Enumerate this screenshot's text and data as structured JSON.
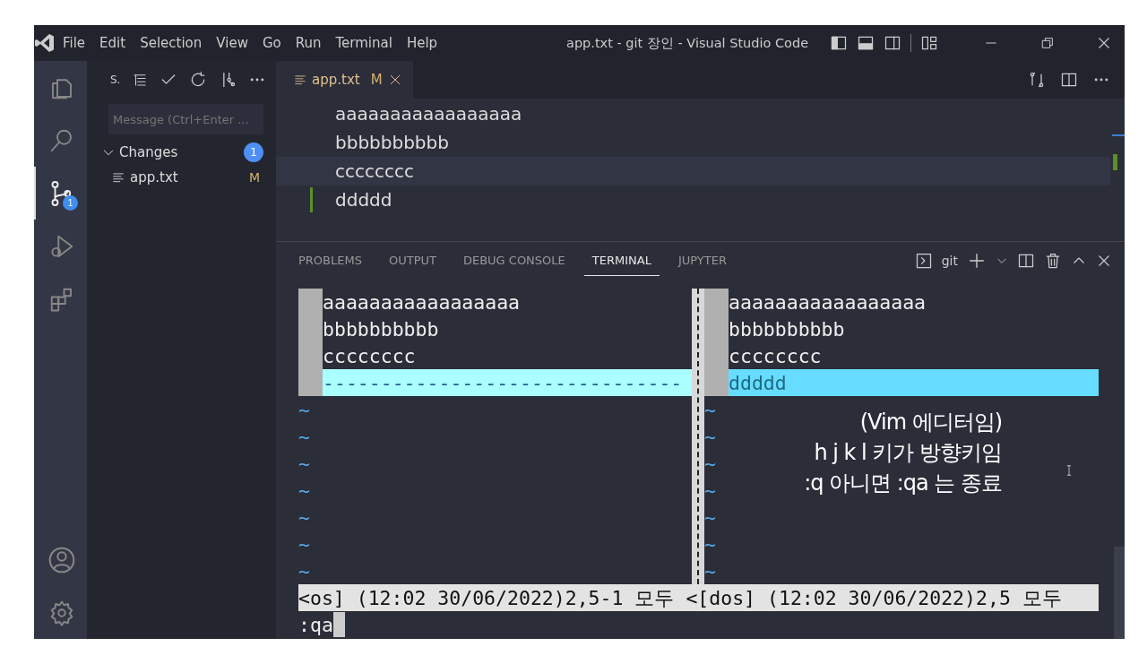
{
  "window": {
    "title": "app.txt - git 장인 - Visual Studio Code"
  },
  "menu": [
    "File",
    "Edit",
    "Selection",
    "View",
    "Go",
    "Run",
    "Terminal",
    "Help"
  ],
  "activity_bar": [
    {
      "kind": "explorer",
      "selected": false
    },
    {
      "kind": "search",
      "selected": false
    },
    {
      "kind": "scm",
      "selected": true,
      "badge": "1"
    },
    {
      "kind": "debug",
      "selected": false
    },
    {
      "kind": "extensions",
      "selected": false
    }
  ],
  "sidebar": {
    "title": "S.",
    "message": {
      "placeholder": "Message (Ctrl+Enter ..."
    },
    "group": {
      "label": "Changes",
      "count": "1",
      "expanded": true,
      "files": [
        {
          "name": "app.txt",
          "status": "M"
        }
      ]
    }
  },
  "editor": {
    "tabs": [
      {
        "label": "app.txt",
        "status": "M",
        "selected": true
      }
    ],
    "lines": [
      {
        "text": "aaaaaaaaaaaaaaaaa",
        "current": false,
        "modified": false
      },
      {
        "text": "bbbbbbbbbb",
        "current": false,
        "modified": false
      },
      {
        "text": "cccccccc",
        "current": true,
        "modified": false
      },
      {
        "text": "ddddd",
        "current": false,
        "modified": true
      }
    ]
  },
  "panel": {
    "tabs": [
      {
        "label": "PROBLEMS",
        "selected": false
      },
      {
        "label": "OUTPUT",
        "selected": false
      },
      {
        "label": "DEBUG CONSOLE",
        "selected": false
      },
      {
        "label": "TERMINAL",
        "selected": true
      },
      {
        "label": "JUPYTER",
        "selected": false
      }
    ],
    "shell": "git",
    "vim": {
      "panes": [
        {
          "lines": [
            {
              "kind": "text",
              "text": "aaaaaaaaaaaaaaaaa"
            },
            {
              "kind": "text",
              "text": "bbbbbbbbbb"
            },
            {
              "kind": "text",
              "text": "cccccccc"
            },
            {
              "kind": "filler",
              "text": "-------------------------------"
            },
            {
              "kind": "tilde",
              "text": "~"
            },
            {
              "kind": "tilde",
              "text": "~"
            },
            {
              "kind": "tilde",
              "text": "~"
            },
            {
              "kind": "tilde",
              "text": "~"
            },
            {
              "kind": "tilde",
              "text": "~"
            },
            {
              "kind": "tilde",
              "text": "~"
            },
            {
              "kind": "tilde",
              "text": "~"
            }
          ],
          "status": "<os] (12:02 30/06/2022)2,5-1 모두"
        },
        {
          "lines": [
            {
              "kind": "text",
              "text": "aaaaaaaaaaaaaaaaa"
            },
            {
              "kind": "text",
              "text": "bbbbbbbbbb"
            },
            {
              "kind": "text",
              "text": "cccccccc"
            },
            {
              "kind": "added",
              "text": "ddddd"
            },
            {
              "kind": "tilde",
              "text": "~"
            },
            {
              "kind": "tilde",
              "text": "~"
            },
            {
              "kind": "tilde",
              "text": "~"
            },
            {
              "kind": "tilde",
              "text": "~"
            },
            {
              "kind": "tilde",
              "text": "~"
            },
            {
              "kind": "tilde",
              "text": "~"
            },
            {
              "kind": "tilde",
              "text": "~"
            }
          ],
          "status": "<[dos] (12:02 30/06/2022)2,5 모두"
        }
      ],
      "command": ":qa"
    },
    "caption": [
      "(Vim 에디터임)",
      "h j k l 키가 방향키임",
      ":q 아니면 :qa 는 종료"
    ]
  }
}
